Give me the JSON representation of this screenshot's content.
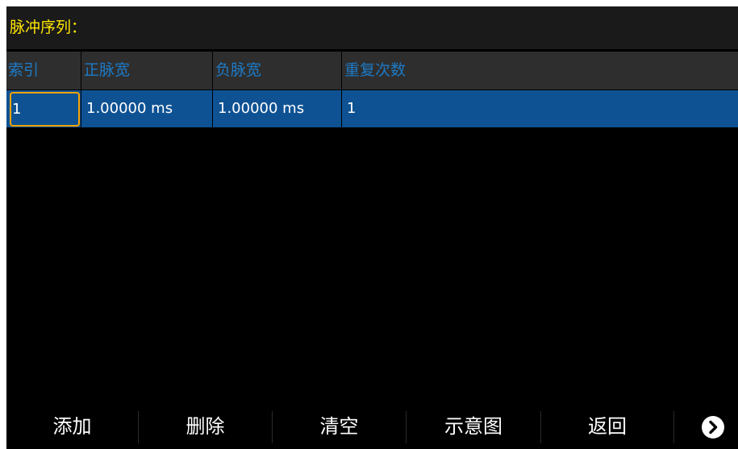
{
  "title": "脉冲序列：",
  "table": {
    "headers": [
      "索引",
      "正脉宽",
      "负脉宽",
      "重复次数"
    ],
    "rows": [
      {
        "index": "1",
        "positive_width": "1.00000 ms",
        "negative_width": "1.00000 ms",
        "repeat_count": "1"
      }
    ]
  },
  "softkeys": {
    "add": "添加",
    "delete": "删除",
    "clear": "清空",
    "diagram": "示意图",
    "back": "返回"
  },
  "icons": {
    "next": "chevron-right-circle-icon"
  },
  "colors": {
    "title_text": "#ffe600",
    "header_text": "#1d7ac6",
    "selected_row": "#0e5293",
    "focus_border": "#f5a300"
  }
}
